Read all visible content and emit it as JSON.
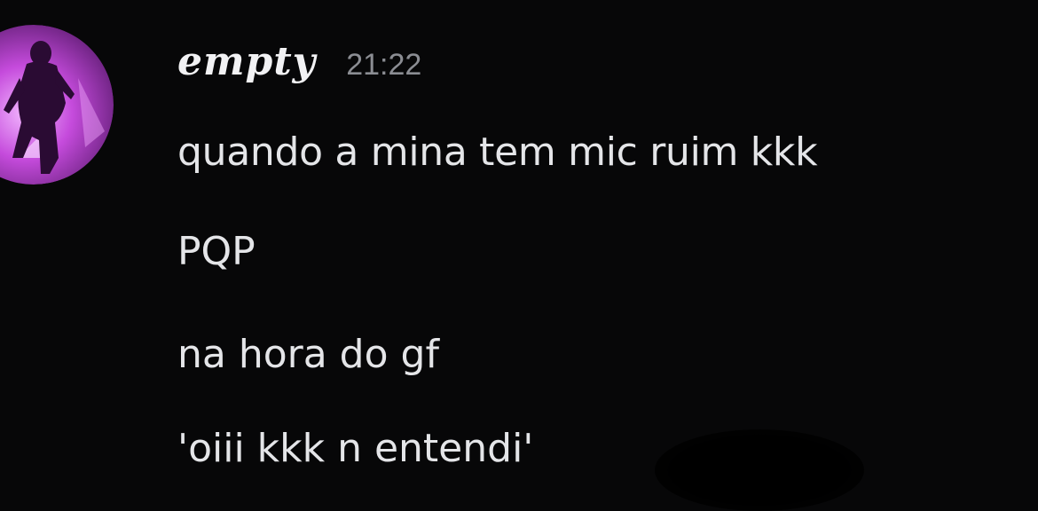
{
  "message": {
    "avatar_icon": "user-avatar-purple-silhouette",
    "username": "empty",
    "timestamp": "21:22",
    "lines": [
      "quando a mina tem mic ruim kkk",
      "PQP",
      "na hora do gf",
      "'oiii kkk n entendi'"
    ]
  },
  "colors": {
    "background": "#070708",
    "text": "#e4e5e8",
    "timestamp": "#8b8d93",
    "avatar_accent": "#c03ad8"
  }
}
